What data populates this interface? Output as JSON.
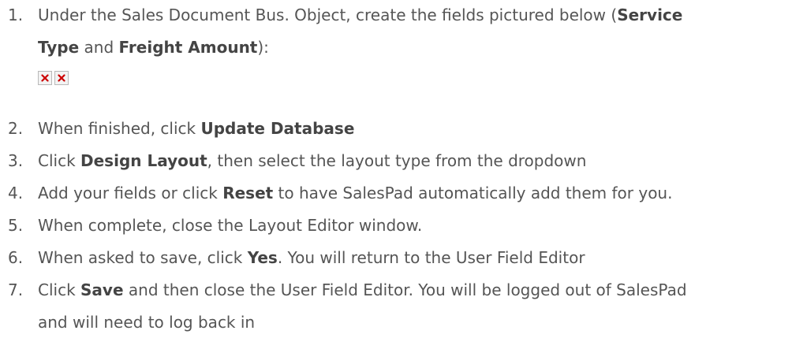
{
  "steps": [
    {
      "num": "1.",
      "parts": {
        "a": "Under the Sales Document Bus. Object, create the fields pictured below (",
        "b1": "Service",
        "b2": "Type",
        "c": " and ",
        "d": "Freight Amount",
        "e": "):"
      }
    },
    {
      "num": "2.",
      "a": "When finished, click ",
      "b": "Update Database",
      "c": ""
    },
    {
      "num": "3.",
      "a": "Click ",
      "b": "Design Layout",
      "c": ", then select the layout type from the dropdown"
    },
    {
      "num": "4.",
      "a": "Add your fields or click ",
      "b": "Reset",
      "c": " to have SalesPad automatically add them for you."
    },
    {
      "num": "5.",
      "a": "When complete, close the Layout Editor window.",
      "b": "",
      "c": ""
    },
    {
      "num": "6.",
      "a": "When asked to save, click ",
      "b": "Yes",
      "c": ". You will return to the User Field Editor"
    },
    {
      "num": "7.",
      "a": "Click ",
      "b": "Save",
      "c": " and then close the User Field Editor. You will be logged out of SalesPad",
      "d": "and will need to log back in"
    }
  ],
  "icons": {
    "broken_image_1": "broken-image-icon",
    "broken_image_2": "broken-image-icon",
    "accent_red": "#cc0000"
  }
}
